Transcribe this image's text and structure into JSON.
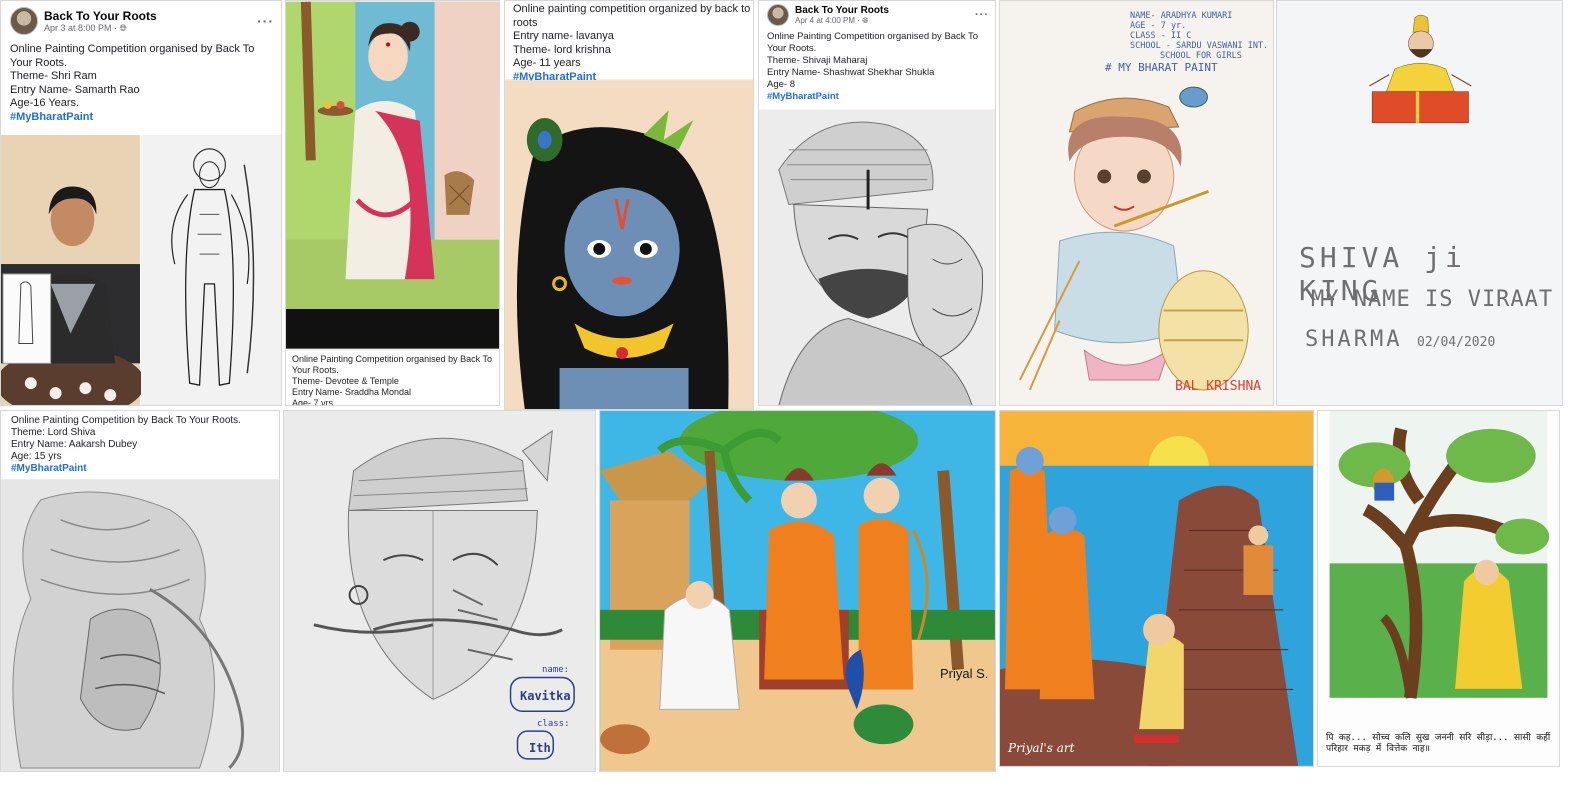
{
  "post1": {
    "page_name": "Back To Your Roots",
    "meta": "Apr 3 at 8:00 PM · ",
    "more": "···",
    "lines": [
      "Online Painting Competition organised by Back To",
      "Your Roots.",
      "Theme- Shri Ram",
      "Entry Name- Samarth Rao",
      "Age-16 Years."
    ],
    "hashtag": "#MyBharatPaint"
  },
  "post2": {
    "lines": [
      "Online Painting Competition organised by Back To",
      "Your Roots.",
      "Theme- Devotee & Temple",
      "Entry Name- Sraddha Mondal",
      "Age- 7 yrs"
    ]
  },
  "post3": {
    "lines": [
      "Online painting competition organized by back to your",
      "roots",
      "Entry name- lavanya",
      "Theme- lord krishna",
      "Age- 11 years"
    ],
    "hashtag": "#MyBharatPaint"
  },
  "post4": {
    "page_name": "Back To Your Roots",
    "meta": "Apr 4 at 4:00 PM · ",
    "more": "···",
    "lines": [
      "Online Painting Competition organised by Back To",
      "Your Roots.",
      "Theme- Shivaji Maharaj",
      "Entry Name- Shashwat Shekhar Shukla",
      "Age- 8"
    ],
    "hashtag": "#MyBharatPaint"
  },
  "post5": {
    "header_lines": [
      "NAME- ARADHYA KUMARI",
      "AGE - 7 yr.",
      "CLASS - II C",
      "SCHOOL - SARDU VASWANI INT.",
      "SCHOOL FOR GIRLS"
    ],
    "hashtag": "# MY BHARAT PAINT",
    "signature": "BAL KRISHNA"
  },
  "post6": {
    "line1": "SHIVA ji KING",
    "line2": "MY NAME IS VIRAAT",
    "line3": "SHARMA",
    "date": "02/04/2020"
  },
  "post7": {
    "lines": [
      "Online Painting Competition by Back To Your Roots.",
      "Theme: Lord Shiva",
      "Entry Name: Aakarsh Dubey",
      "Age: 15 yrs"
    ],
    "hashtag": "#MyBharatPaint"
  },
  "post8": {
    "name_label": "name:",
    "name": "Kavitka",
    "class_label": "class:",
    "class_value": "Ith"
  },
  "post9": {
    "signature": "Priyal S."
  },
  "post10": {
    "signature": "Priyal's art"
  },
  "post11": {
    "footer": "पि कह... सोच्च कलि सुख जननी सरि सीड़ा... सासी कहीं परिहार मकड़ में वित्तेक नाह॥"
  },
  "colors": {
    "facebook_blue": "#216fdb",
    "sky_blue": "#3fb7e6",
    "saffron": "#f07f1e",
    "skin_blue": "#6e8fb5",
    "pencil_gray": "#8a8a8a"
  }
}
